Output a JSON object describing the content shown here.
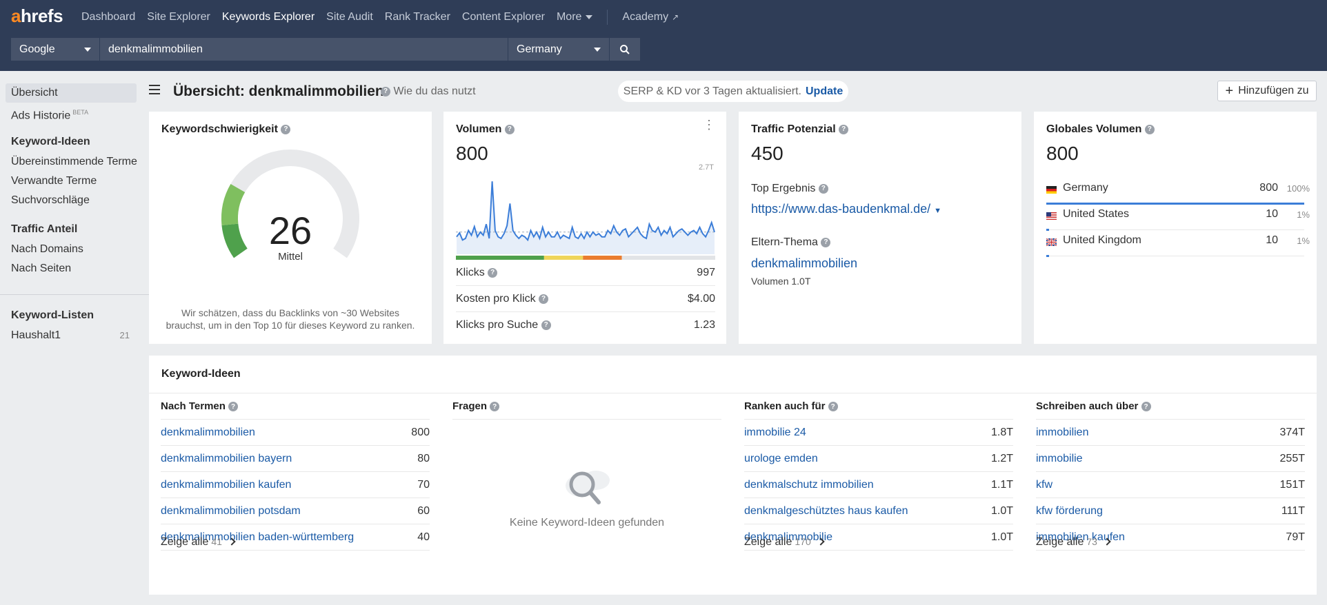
{
  "app": {
    "logo_a": "a",
    "logo_rest": "hrefs"
  },
  "nav": {
    "items": [
      "Dashboard",
      "Site Explorer",
      "Keywords Explorer",
      "Site Audit",
      "Rank Tracker",
      "Content Explorer"
    ],
    "more": "More",
    "academy": "Academy"
  },
  "search": {
    "engine": "Google",
    "query": "denkmalimmobilien",
    "country": "Germany"
  },
  "sidebar": {
    "overview": "Übersicht",
    "ads_history": "Ads Historie",
    "beta": "BETA",
    "ideas_head": "Keyword-Ideen",
    "matching": "Übereinstimmende Terme",
    "related": "Verwandte Terme",
    "suggestions": "Suchvorschläge",
    "traffic_head": "Traffic Anteil",
    "by_domains": "Nach Domains",
    "by_pages": "Nach Seiten",
    "lists_head": "Keyword-Listen",
    "list_name": "Haushalt1",
    "list_count": "21"
  },
  "header": {
    "title": "Übersicht: denkmalimmobilien",
    "howto": "Wie du das nutzt",
    "serp_text": "SERP & KD vor 3 Tagen aktualisiert.",
    "update": "Update",
    "add_btn": "Hinzufügen zu"
  },
  "kd": {
    "title": "Keywordschwierigkeit",
    "value": "26",
    "level": "Mittel",
    "value_fraction": 0.26,
    "desc1": "Wir schätzen, dass du Backlinks von ~30 Websites",
    "desc2": "brauchst, um in den Top 10 für dieses Keyword zu ranken."
  },
  "volume": {
    "title": "Volumen",
    "value": "800",
    "chart_max": "2.7T",
    "series": [
      22,
      27,
      18,
      20,
      30,
      24,
      35,
      22,
      28,
      24,
      38,
      20,
      92,
      30,
      22,
      20,
      26,
      36,
      64,
      30,
      24,
      20,
      24,
      22,
      18,
      30,
      22,
      28,
      20,
      34,
      22,
      28,
      22,
      22,
      28,
      20,
      24,
      22,
      20,
      34,
      22,
      20,
      26,
      20,
      28,
      22,
      28,
      24,
      26,
      22,
      22,
      30,
      26,
      36,
      28,
      24,
      30,
      32,
      22,
      26,
      30,
      34,
      26,
      22,
      20,
      38,
      30,
      28,
      34,
      24,
      30,
      26,
      34,
      22,
      26,
      30,
      32,
      28,
      24,
      28,
      30,
      26,
      34,
      26,
      22,
      30,
      40,
      28
    ],
    "avg": 28,
    "clicks_label": "Klicks",
    "clicks": "997",
    "cpc_label": "Kosten pro Klick",
    "cpc": "$4.00",
    "cps_label": "Klicks pro Suche",
    "cps": "1.23",
    "segments": [
      {
        "color": "#4fa14c",
        "share": 0.34
      },
      {
        "color": "#efd55a",
        "share": 0.15
      },
      {
        "color": "#ea7d2f",
        "share": 0.15
      },
      {
        "color": "#e2e4e7",
        "share": 0.36
      }
    ]
  },
  "traffic": {
    "title": "Traffic Potenzial",
    "value": "450",
    "top_label": "Top Ergebnis",
    "top_url": "https://www.das-baudenkmal.de/",
    "parent_label": "Eltern-Thema",
    "parent_kw": "denkmalimmobilien",
    "parent_vol": "Volumen 1.0T"
  },
  "global": {
    "title": "Globales Volumen",
    "value": "800",
    "countries": [
      {
        "name": "Germany",
        "vol": "800",
        "pct": "100%",
        "share": 1.0
      },
      {
        "name": "United States",
        "vol": "10",
        "pct": "1%",
        "share": 0.01
      },
      {
        "name": "United Kingdom",
        "vol": "10",
        "pct": "1%",
        "share": 0.01
      }
    ]
  },
  "ideas": {
    "title": "Keyword-Ideen",
    "terms": {
      "head": "Nach Termen",
      "rows": [
        {
          "kw": "denkmalimmobilien",
          "v": "800"
        },
        {
          "kw": "denkmalimmobilien bayern",
          "v": "80"
        },
        {
          "kw": "denkmalimmobilien kaufen",
          "v": "70"
        },
        {
          "kw": "denkmalimmobilien potsdam",
          "v": "60"
        },
        {
          "kw": "denkmalimmobilien baden-württemberg",
          "v": "40"
        }
      ],
      "show": "Zeige alle",
      "count": "41"
    },
    "questions": {
      "head": "Fragen",
      "empty": "Keine Keyword-Ideen gefunden"
    },
    "ranks": {
      "head": "Ranken auch für",
      "rows": [
        {
          "kw": "immobilie 24",
          "v": "1.8T"
        },
        {
          "kw": "urologe emden",
          "v": "1.2T"
        },
        {
          "kw": "denkmalschutz immobilien",
          "v": "1.1T"
        },
        {
          "kw": "denkmalgeschütztes haus kaufen",
          "v": "1.0T"
        },
        {
          "kw": "denkmalimmobilie",
          "v": "1.0T"
        }
      ],
      "show": "Zeige alle",
      "count": "170"
    },
    "writes": {
      "head": "Schreiben auch über",
      "rows": [
        {
          "kw": "immobilien",
          "v": "374T"
        },
        {
          "kw": "immobilie",
          "v": "255T"
        },
        {
          "kw": "kfw",
          "v": "151T"
        },
        {
          "kw": "kfw förderung",
          "v": "111T"
        },
        {
          "kw": "immobilien kaufen",
          "v": "79T"
        }
      ],
      "show": "Zeige alle",
      "count": "73"
    }
  }
}
